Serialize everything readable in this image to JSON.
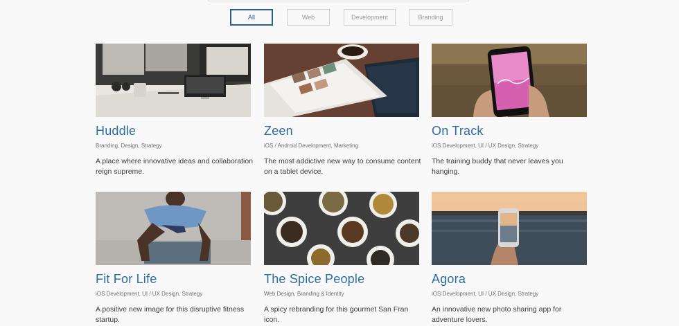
{
  "filters": [
    {
      "label": "All",
      "active": true
    },
    {
      "label": "Web",
      "active": false
    },
    {
      "label": "Development",
      "active": false
    },
    {
      "label": "Branding",
      "active": false
    }
  ],
  "projects": [
    {
      "title": "Huddle",
      "categories": "Branding, Design, Strategy",
      "description": "A place where innovative ideas and collaboration reign supreme.",
      "image": "office-desk-photo"
    },
    {
      "title": "Zeen",
      "categories": "iOS / Android Development, Marketing",
      "description": "The most addictive new way to consume content on a tablet device.",
      "image": "tablet-coffee-photo"
    },
    {
      "title": "On Track",
      "categories": "iOS Development, UI / UX Design, Strategy",
      "description": "The training buddy that never leaves you hanging.",
      "image": "phone-in-hand-photo"
    },
    {
      "title": "Fit For Life",
      "categories": "iOS Development, UI / UX Design, Strategy",
      "description": "A positive new image for this disruptive fitness startup.",
      "image": "fitness-man-photo"
    },
    {
      "title": "The Spice People",
      "categories": "Web Design, Branding & Identity",
      "description": "A spicy rebranding for this gourmet San Fran icon.",
      "image": "spice-cups-photo"
    },
    {
      "title": "Agora",
      "categories": "iOS Development, UI / UX Design, Strategy",
      "description": "An innovative new photo sharing app for adventure lovers.",
      "image": "phone-lake-photo"
    }
  ],
  "colors": {
    "accent": "#2d6ba3",
    "active_border": "#2b5f94",
    "background": "#f9f9f9"
  }
}
